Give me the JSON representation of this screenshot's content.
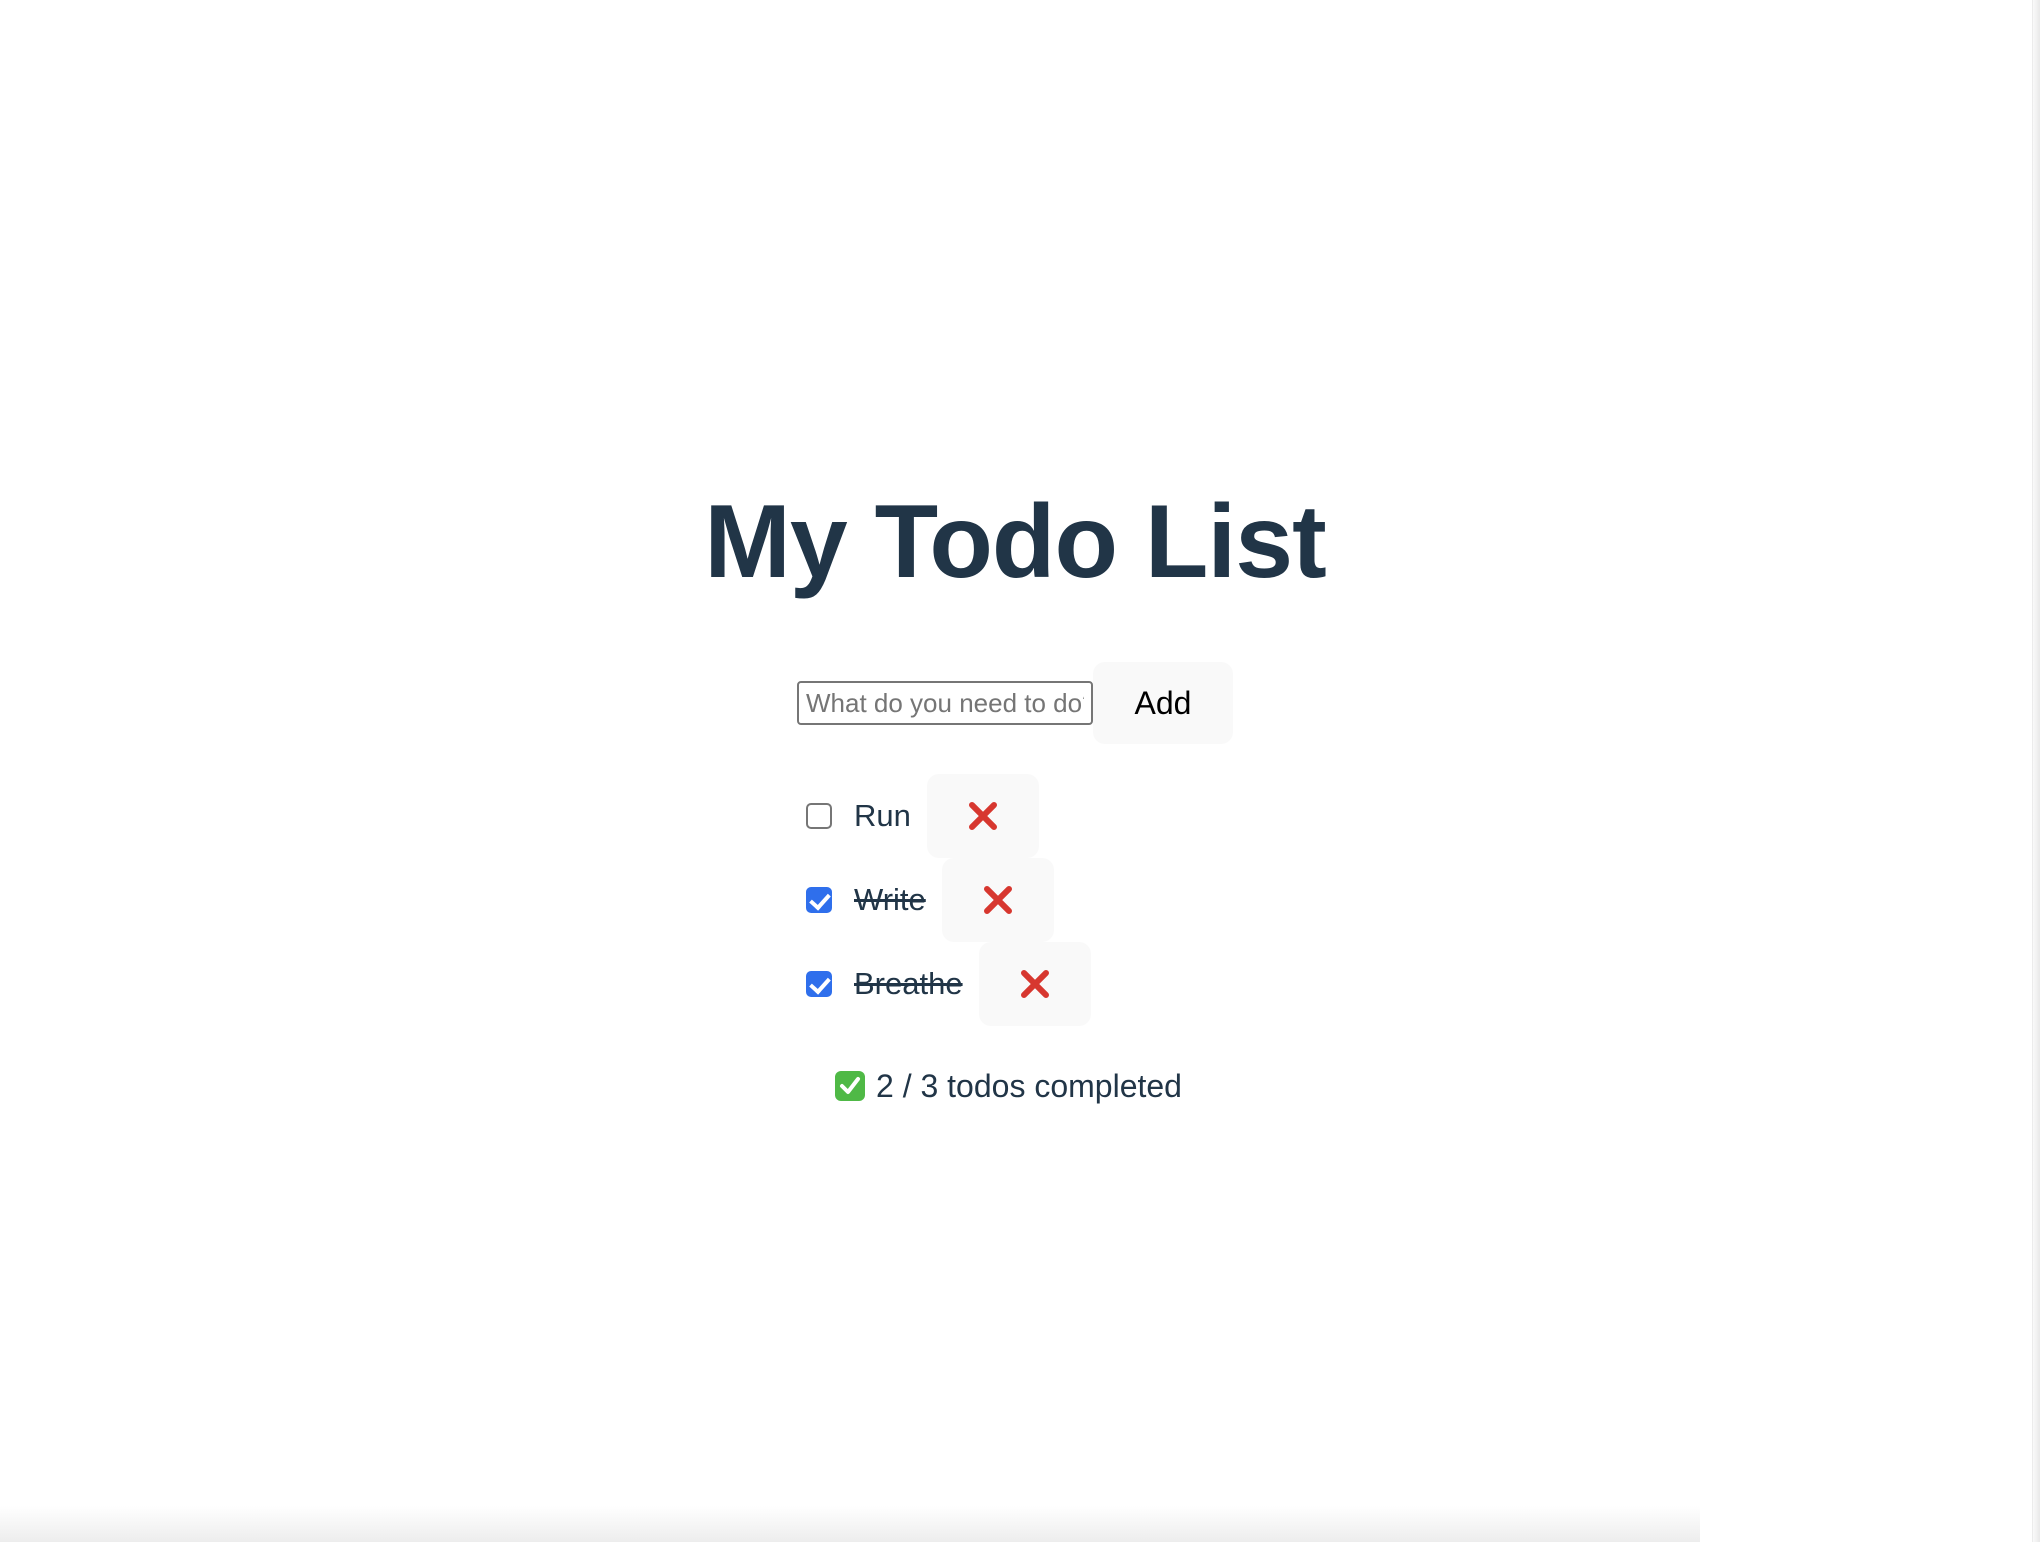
{
  "page": {
    "title": "My Todo List"
  },
  "form": {
    "placeholder": "What do you need to do?",
    "value": "",
    "add_label": "Add"
  },
  "todos": [
    {
      "label": "Run",
      "completed": false
    },
    {
      "label": "Write",
      "completed": true
    },
    {
      "label": "Breathe",
      "completed": true
    }
  ],
  "summary": {
    "text": "2 / 3 todos completed",
    "icon": "check-mark-icon"
  },
  "colors": {
    "text": "#213547",
    "checkbox_checked": "#2f6fec",
    "delete_x": "#d7372f",
    "button_bg": "#f9f9f9",
    "summary_icon": "#4fb946"
  }
}
